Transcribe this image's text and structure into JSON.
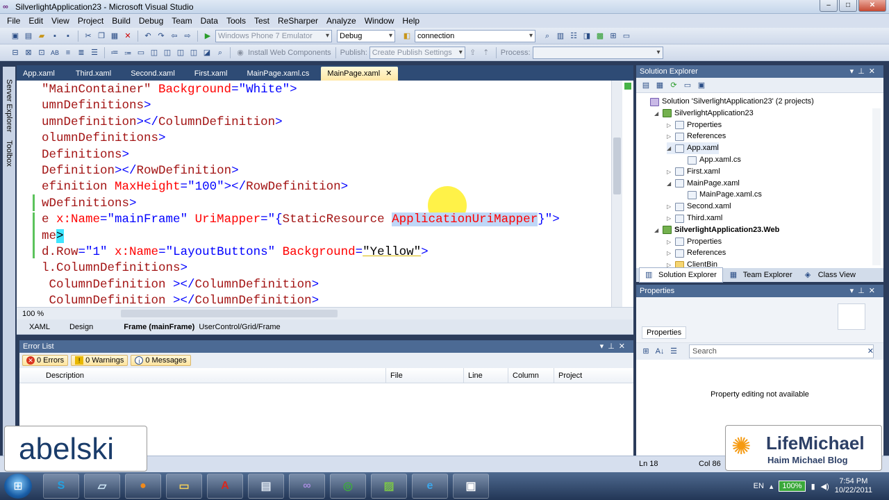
{
  "window": {
    "title": "SilverlightApplication23 - Microsoft Visual Studio",
    "controls": [
      "–",
      "□",
      "✕"
    ]
  },
  "menu": [
    "File",
    "Edit",
    "View",
    "Project",
    "Build",
    "Debug",
    "Team",
    "Data",
    "Tools",
    "Test",
    "ReSharper",
    "Analyze",
    "Window",
    "Help"
  ],
  "toolbar1": {
    "platform": "Windows Phone 7 Emulator",
    "config": "Debug",
    "find": "connection"
  },
  "toolbar2": {
    "install_web_components": "Install Web Components",
    "publish_label": "Publish:",
    "publish_settings": "Create Publish Settings",
    "process_label": "Process:"
  },
  "sidestrip": {
    "server_explorer": "Server Explorer",
    "toolbox": "Toolbox"
  },
  "doc_tabs": [
    "App.xaml",
    "Third.xaml",
    "Second.xaml",
    "First.xaml",
    "MainPage.xaml.cs",
    "MainPage.xaml"
  ],
  "active_tab_close": "✕",
  "editor": {
    "lines": [
      {
        "parts": [
          [
            "tg",
            "\"MainContainer\" "
          ],
          [
            "at",
            "Background"
          ],
          [
            "pu",
            "="
          ],
          [
            "vl",
            "\"White\""
          ],
          [
            "pu",
            ">"
          ]
        ]
      },
      {
        "parts": [
          [
            "tg",
            "umnDefinitions"
          ],
          [
            "pu",
            ">"
          ]
        ]
      },
      {
        "parts": [
          [
            "tg",
            "umnDefinition"
          ],
          [
            "pu",
            "></"
          ],
          [
            "tg",
            "ColumnDefinition"
          ],
          [
            "pu",
            ">"
          ]
        ]
      },
      {
        "parts": [
          [
            "tg",
            "olumnDefinitions"
          ],
          [
            "pu",
            ">"
          ]
        ]
      },
      {
        "parts": [
          [
            "tg",
            "Definitions"
          ],
          [
            "pu",
            ">"
          ]
        ]
      },
      {
        "parts": [
          [
            "tg",
            "Definition"
          ],
          [
            "pu",
            "></"
          ],
          [
            "tg",
            "RowDefinition"
          ],
          [
            "pu",
            ">"
          ]
        ]
      },
      {
        "parts": [
          [
            "tg",
            "efinition "
          ],
          [
            "at",
            "MaxHeight"
          ],
          [
            "pu",
            "="
          ],
          [
            "vl",
            "\"100\""
          ],
          [
            "pu",
            "></"
          ],
          [
            "tg",
            "RowDefinition"
          ],
          [
            "pu",
            ">"
          ]
        ]
      },
      {
        "parts": [
          [
            "tg",
            "wDefinitions"
          ],
          [
            "pu",
            ">"
          ]
        ]
      },
      {
        "parts": [
          [
            "tg",
            "e "
          ],
          [
            "at",
            "x:Name"
          ],
          [
            "pu",
            "="
          ],
          [
            "vl",
            "\"mainFrame\" "
          ],
          [
            "at",
            "UriMapper"
          ],
          [
            "pu",
            "="
          ],
          [
            "vl",
            "\"{"
          ],
          [
            "tg",
            "StaticResource "
          ],
          [
            "hl",
            "ApplicationUriMapper"
          ],
          [
            "vl",
            "}\""
          ],
          [
            "pu",
            ">"
          ]
        ]
      },
      {
        "parts": [
          [
            "tg",
            "me"
          ],
          [
            "hl2",
            ">"
          ]
        ]
      },
      {
        "parts": [
          [
            "tg",
            "d.Row"
          ],
          [
            "pu",
            "="
          ],
          [
            "vl",
            "\"1\" "
          ],
          [
            "at",
            "x:Name"
          ],
          [
            "pu",
            "="
          ],
          [
            "vl",
            "\"LayoutButtons\" "
          ],
          [
            "at",
            "Background"
          ],
          [
            "pu",
            "="
          ],
          [
            "und",
            "\"Yellow\""
          ],
          [
            "pu",
            ">"
          ]
        ]
      },
      {
        "parts": [
          [
            "tg",
            "l.ColumnDefinitions"
          ],
          [
            "pu",
            ">"
          ]
        ]
      },
      {
        "parts": [
          [
            "tg",
            " ColumnDefinition "
          ],
          [
            "pu",
            "></"
          ],
          [
            "tg",
            "ColumnDefinition"
          ],
          [
            "pu",
            ">"
          ]
        ]
      },
      {
        "parts": [
          [
            "tg",
            " ColumnDefinition "
          ],
          [
            "pu",
            "></"
          ],
          [
            "tg",
            "ColumnDefinition"
          ],
          [
            "pu",
            ">"
          ]
        ]
      }
    ]
  },
  "zoom": "100 %",
  "designbar": {
    "xaml_tab": "XAML",
    "design_tab": "Design",
    "element": "Frame (mainFrame)",
    "path": "UserControl/Grid/Frame"
  },
  "error_list": {
    "title": "Error List",
    "errors": "0 Errors",
    "warnings": "0 Warnings",
    "messages": "0 Messages",
    "columns": [
      "Description",
      "File",
      "Line",
      "Column",
      "Project"
    ]
  },
  "solution_explorer": {
    "title": "Solution Explorer",
    "nodes": [
      {
        "label": "Solution 'SilverlightApplication23' (2 projects)",
        "level": 0,
        "icon": "sol",
        "tri": ""
      },
      {
        "label": "SilverlightApplication23",
        "level": 1,
        "icon": "proj",
        "tri": "◢"
      },
      {
        "label": "Properties",
        "level": 2,
        "icon": "file",
        "tri": "▷"
      },
      {
        "label": "References",
        "level": 2,
        "icon": "file",
        "tri": "▷"
      },
      {
        "label": "App.xaml",
        "level": 2,
        "icon": "file",
        "tri": "◢",
        "sel": true
      },
      {
        "label": "App.xaml.cs",
        "level": 3,
        "icon": "file",
        "tri": ""
      },
      {
        "label": "First.xaml",
        "level": 2,
        "icon": "file",
        "tri": "▷"
      },
      {
        "label": "MainPage.xaml",
        "level": 2,
        "icon": "file",
        "tri": "◢"
      },
      {
        "label": "MainPage.xaml.cs",
        "level": 3,
        "icon": "file",
        "tri": ""
      },
      {
        "label": "Second.xaml",
        "level": 2,
        "icon": "file",
        "tri": "▷"
      },
      {
        "label": "Third.xaml",
        "level": 2,
        "icon": "file",
        "tri": "▷"
      },
      {
        "label": "SilverlightApplication23.Web",
        "level": 1,
        "icon": "proj",
        "tri": "◢",
        "bold": true
      },
      {
        "label": "Properties",
        "level": 2,
        "icon": "file",
        "tri": "▷"
      },
      {
        "label": "References",
        "level": 2,
        "icon": "file",
        "tri": "▷"
      },
      {
        "label": "ClientBin",
        "level": 2,
        "icon": "folder",
        "tri": "▷"
      }
    ],
    "tabs": [
      "Solution Explorer",
      "Team Explorer",
      "Class View"
    ]
  },
  "properties": {
    "title": "Properties",
    "tab": "Properties",
    "search_placeholder": "Search",
    "empty_message": "Property editing not available"
  },
  "statusbar": {
    "ln": "Ln 18",
    "col": "Col 86"
  },
  "taskbar": {
    "lang": "EN",
    "battery": "100%",
    "time": "7:54 PM",
    "date": "10/22/2011"
  },
  "watermarks": {
    "left": "abelski",
    "right_title": "LifeMichael",
    "right_sub": "Haim Michael Blog"
  },
  "colors": {
    "accent": "#2e4b75",
    "panel_head": "#4c6a94",
    "tag": "#a31515",
    "attr": "#ff0000",
    "value": "#0000ff"
  }
}
